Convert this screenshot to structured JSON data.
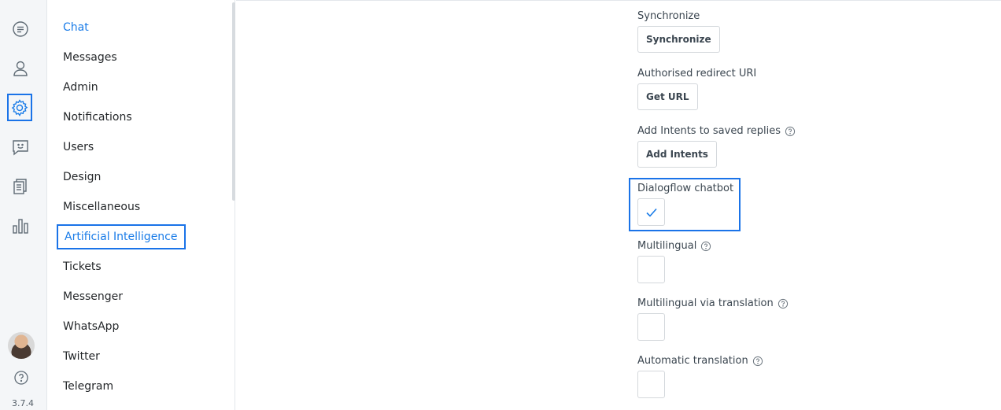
{
  "rail": {
    "icons": [
      "chat-icon",
      "user-icon",
      "settings-icon",
      "smiley-chat-icon",
      "articles-icon",
      "reports-icon"
    ],
    "version": "3.7.4",
    "accent": "#1a73e8"
  },
  "menu": {
    "items": [
      {
        "label": "Chat"
      },
      {
        "label": "Messages"
      },
      {
        "label": "Admin"
      },
      {
        "label": "Notifications"
      },
      {
        "label": "Users"
      },
      {
        "label": "Design"
      },
      {
        "label": "Miscellaneous"
      },
      {
        "label": "Artificial Intelligence"
      },
      {
        "label": "Tickets"
      },
      {
        "label": "Messenger"
      },
      {
        "label": "WhatsApp"
      },
      {
        "label": "Twitter"
      },
      {
        "label": "Telegram"
      }
    ]
  },
  "settings": {
    "synchronize": {
      "label": "Synchronize",
      "button": "Synchronize"
    },
    "redirect_uri": {
      "label": "Authorised redirect URI",
      "button": "Get URL"
    },
    "intents": {
      "label": "Add Intents to saved replies",
      "button": "Add Intents"
    },
    "dialogflow": {
      "label": "Dialogflow chatbot",
      "checked": true
    },
    "multilingual": {
      "label": "Multilingual",
      "checked": false
    },
    "multilingual_translation": {
      "label": "Multilingual via translation",
      "checked": false
    },
    "automatic_translation": {
      "label": "Automatic translation",
      "checked": false
    }
  }
}
